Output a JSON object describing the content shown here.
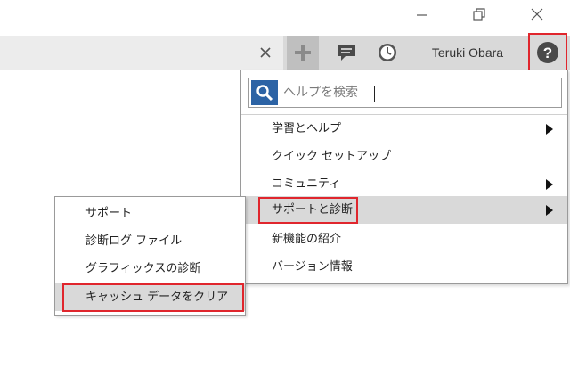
{
  "window": {
    "minimize_icon": "minimize-icon",
    "restore_icon": "restore-icon",
    "close_icon": "close-icon"
  },
  "toolbar": {
    "tab_close_icon": "close-tab-icon",
    "new_icon": "plus-icon",
    "comment_icon": "comment-icon",
    "clock_icon": "clock-icon",
    "user_name": "Teruki Obara",
    "help_icon": "question-circle-icon"
  },
  "help_menu": {
    "search": {
      "placeholder": "ヘルプを検索",
      "value": "",
      "icon": "search-icon"
    },
    "items": [
      {
        "label": "学習とヘルプ",
        "has_submenu": true
      },
      {
        "label": "クイック セットアップ",
        "has_submenu": false
      },
      {
        "label": "コミュニティ",
        "has_submenu": true
      },
      {
        "label": "サポートと診断",
        "has_submenu": true,
        "highlighted": true
      },
      {
        "label": "新機能の紹介",
        "has_submenu": false
      },
      {
        "label": "バージョン情報",
        "has_submenu": false
      }
    ]
  },
  "submenu": {
    "items": [
      {
        "label": "サポート"
      },
      {
        "label": "診断ログ ファイル"
      },
      {
        "label": "グラフィックスの診断"
      },
      {
        "label": "キャッシュ データをクリア",
        "highlighted": true
      }
    ]
  },
  "colors": {
    "highlight_border": "#e0262d",
    "search_icon_bg": "#2c63a5",
    "toolbar_bg": "#d9d9d9"
  }
}
